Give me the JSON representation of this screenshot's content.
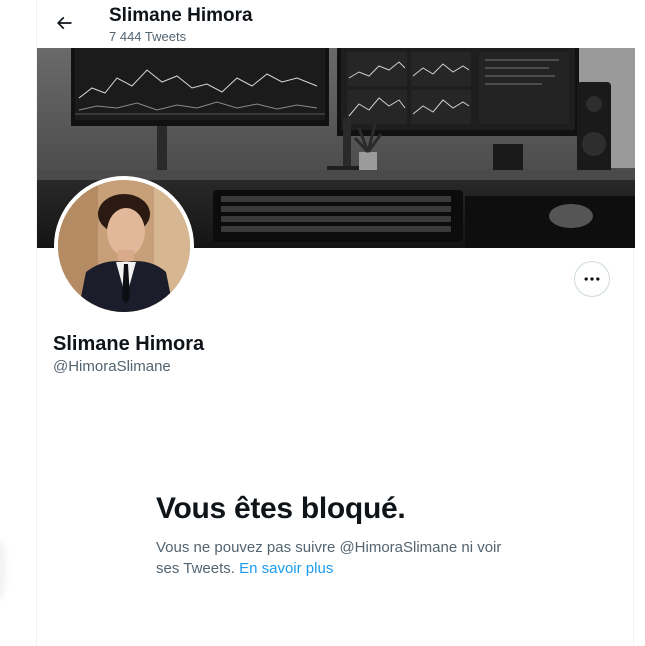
{
  "header": {
    "back_icon": "arrow-left-icon",
    "title": "Slimane Himora",
    "tweet_count": "7 444 Tweets"
  },
  "banner": {
    "description_icon": "desk-setup-photo"
  },
  "profile": {
    "name": "Slimane Himora",
    "handle": "@HimoraSlimane",
    "more_icon": "more-horizontal-icon"
  },
  "blocked": {
    "title": "Vous êtes bloqué.",
    "message": "Vous ne pouvez pas suivre @HimoraSlimane ni voir ses Tweets.",
    "link": "En savoir plus"
  },
  "colors": {
    "text_primary": "#0f1419",
    "text_secondary": "#536471",
    "link": "#1d9bf0",
    "border": "#cfd9de"
  }
}
